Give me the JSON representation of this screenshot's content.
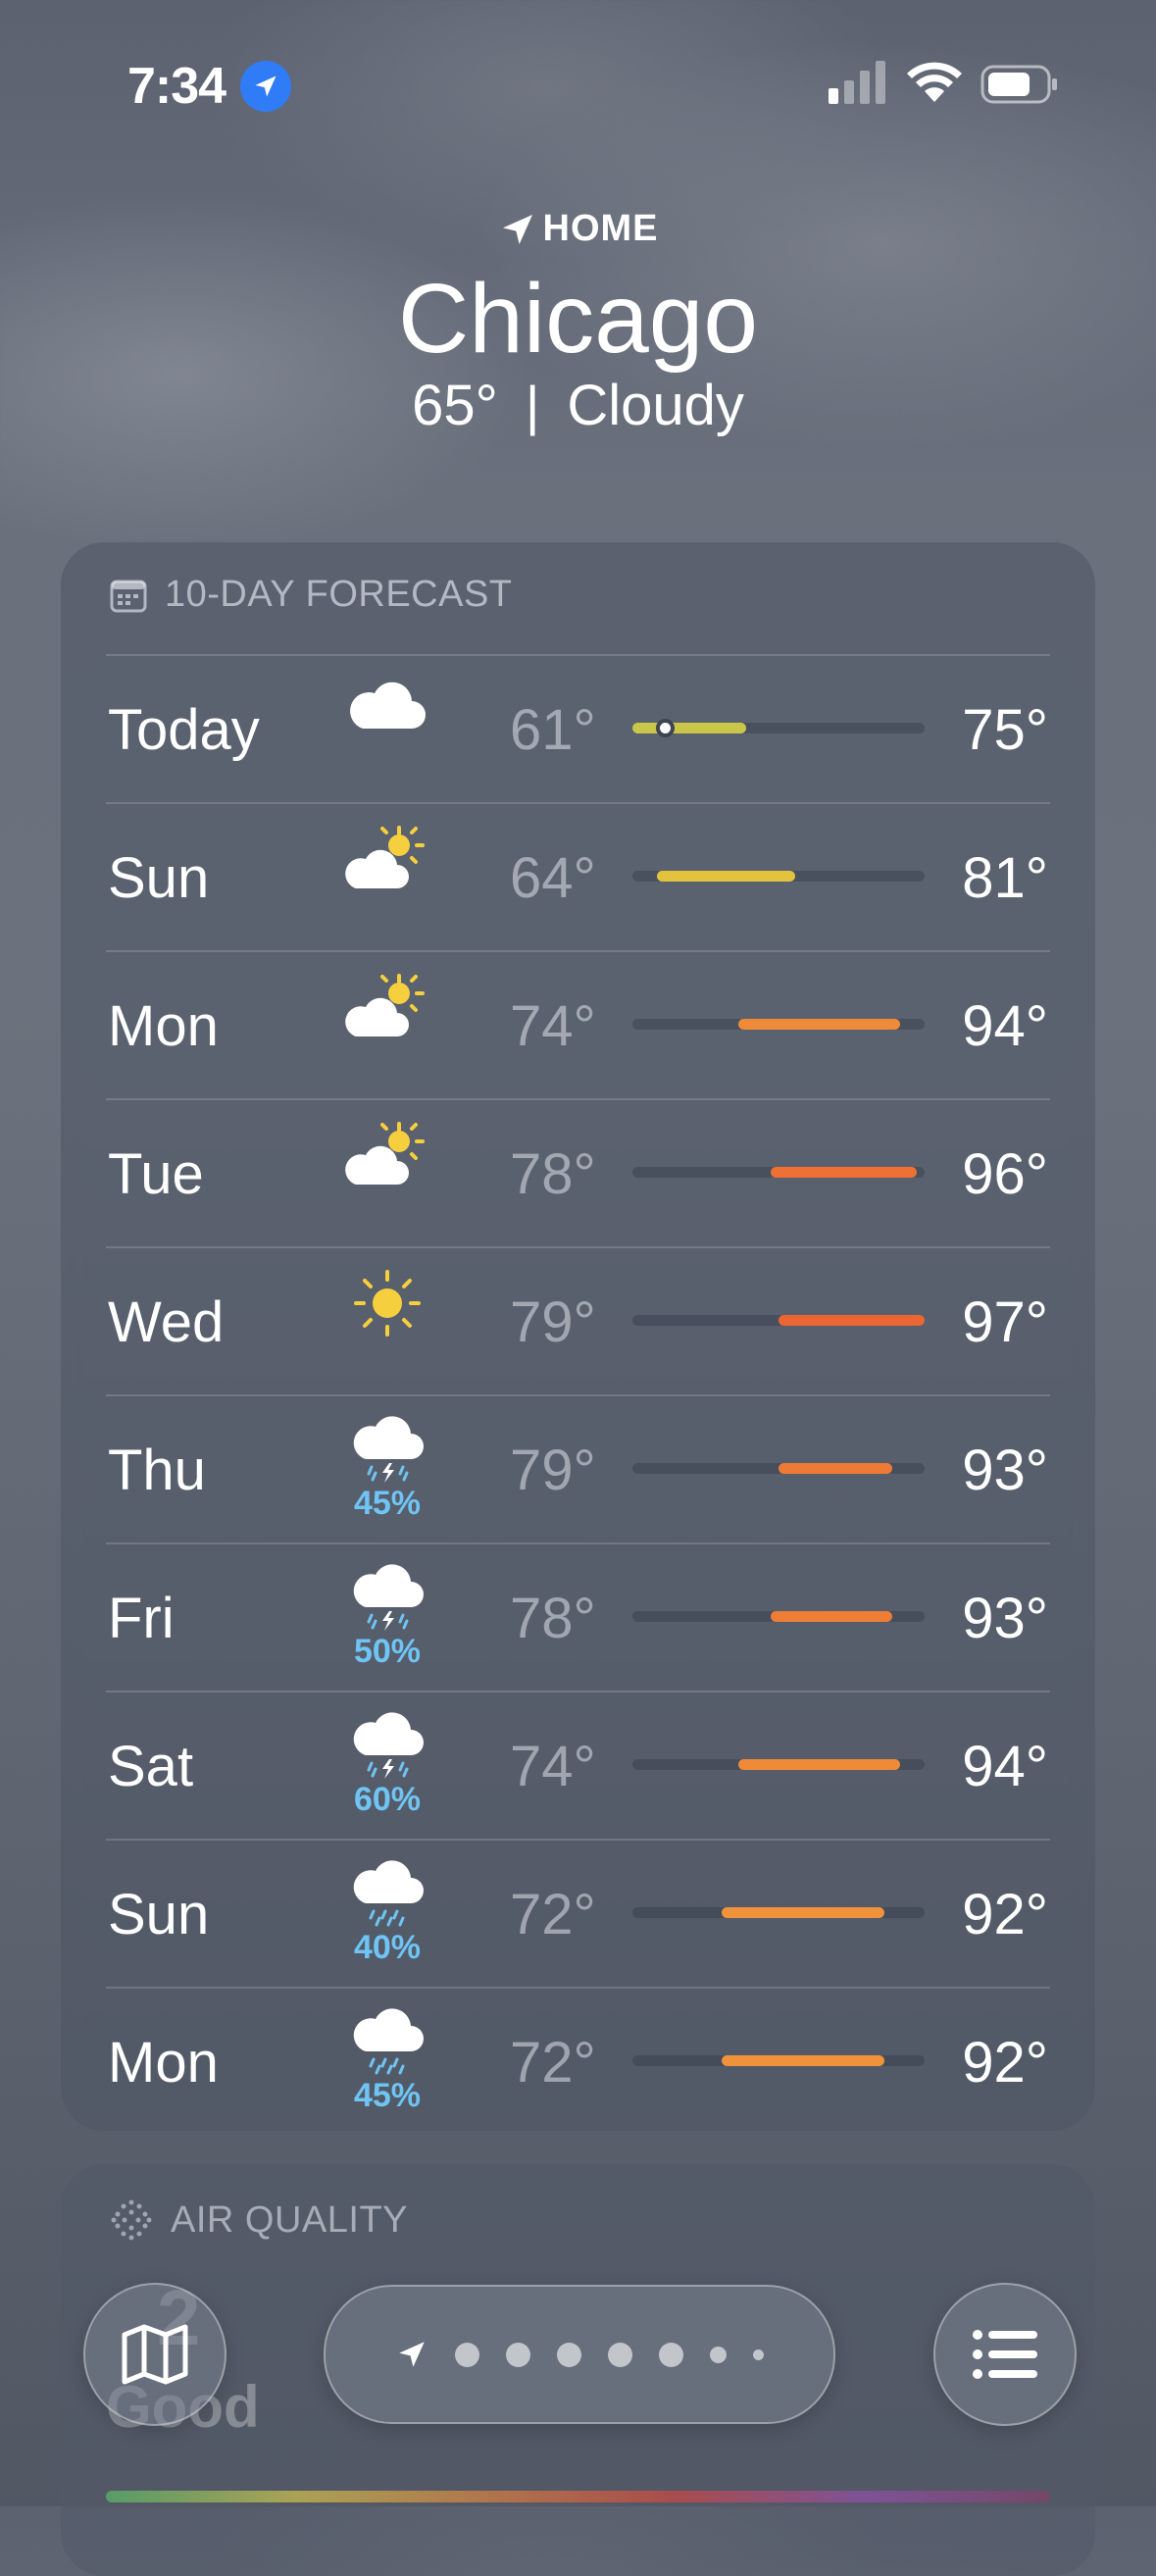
{
  "status_bar": {
    "time": "7:34"
  },
  "header": {
    "location_label": "HOME",
    "city": "Chicago",
    "temperature": "65°",
    "separator": "|",
    "condition": "Cloudy"
  },
  "forecast": {
    "title": "10-DAY FORECAST",
    "range_min": 61,
    "range_max": 97,
    "current_temp": 65,
    "days": [
      {
        "day": "Today",
        "icon": "cloud-icon",
        "precip": "",
        "low": "61°",
        "high": "75°",
        "low_val": 61,
        "high_val": 75,
        "color": "#c9c64a"
      },
      {
        "day": "Sun",
        "icon": "partly-sunny-icon",
        "precip": "",
        "low": "64°",
        "high": "81°",
        "low_val": 64,
        "high_val": 81,
        "color": "#e3c33e"
      },
      {
        "day": "Mon",
        "icon": "partly-sunny-icon",
        "precip": "",
        "low": "74°",
        "high": "94°",
        "low_val": 74,
        "high_val": 94,
        "color": "#ef8a38"
      },
      {
        "day": "Tue",
        "icon": "partly-sunny-icon",
        "precip": "",
        "low": "78°",
        "high": "96°",
        "low_val": 78,
        "high_val": 96,
        "color": "#ee7035"
      },
      {
        "day": "Wed",
        "icon": "sun-icon",
        "precip": "",
        "low": "79°",
        "high": "97°",
        "low_val": 79,
        "high_val": 97,
        "color": "#ec6633"
      },
      {
        "day": "Thu",
        "icon": "thunderstorm-icon",
        "precip": "45%",
        "low": "79°",
        "high": "93°",
        "low_val": 79,
        "high_val": 93,
        "color": "#ee7a36"
      },
      {
        "day": "Fri",
        "icon": "thunderstorm-icon",
        "precip": "50%",
        "low": "78°",
        "high": "93°",
        "low_val": 78,
        "high_val": 93,
        "color": "#ee7d36"
      },
      {
        "day": "Sat",
        "icon": "thunderstorm-icon",
        "precip": "60%",
        "low": "74°",
        "high": "94°",
        "low_val": 74,
        "high_val": 94,
        "color": "#ef8a38"
      },
      {
        "day": "Sun",
        "icon": "rain-icon",
        "precip": "40%",
        "low": "72°",
        "high": "92°",
        "low_val": 72,
        "high_val": 92,
        "color": "#f0923a"
      },
      {
        "day": "Mon",
        "icon": "rain-icon",
        "precip": "45%",
        "low": "72°",
        "high": "92°",
        "low_val": 72,
        "high_val": 92,
        "color": "#f0923a"
      }
    ]
  },
  "air_quality": {
    "title": "AIR QUALITY",
    "value": "2",
    "label": "Good"
  },
  "toolbar": {
    "map_icon": "map-icon",
    "pager_dots": 7,
    "list_icon": "list-icon"
  },
  "colors": {
    "accent_blue": "#2f7cf6",
    "precip_blue": "#6fc4f3"
  }
}
